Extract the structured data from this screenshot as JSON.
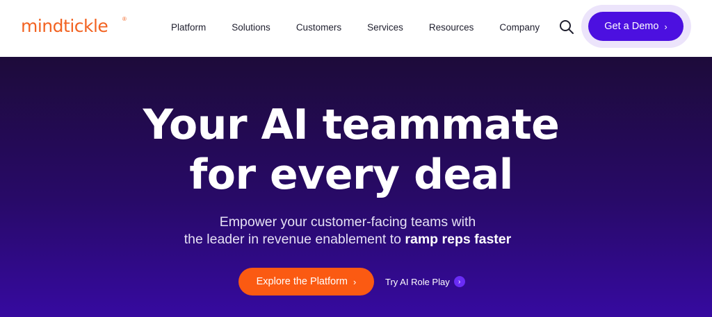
{
  "header": {
    "logo_text": "mindtickle",
    "logo_mark": "®",
    "nav": [
      {
        "label": "Platform"
      },
      {
        "label": "Solutions"
      },
      {
        "label": "Customers"
      },
      {
        "label": "Services"
      },
      {
        "label": "Resources"
      },
      {
        "label": "Company"
      }
    ],
    "search_icon": "search-icon",
    "demo_label": "Get a Demo",
    "demo_chevron": "›"
  },
  "hero": {
    "headline_line1": "Your AI teammate",
    "headline_line2": "for every deal",
    "sub_line1": "Empower your customer-facing teams with",
    "sub_line2_plain": "the leader in revenue enablement to",
    "sub_line2_bold": "ramp reps faster",
    "cta_primary": "Explore the Platform",
    "cta_primary_chevron": "›",
    "cta_secondary": "Try AI Role Play",
    "cta_secondary_chevron": "›"
  },
  "colors": {
    "brand_orange": "#f26322",
    "cta_orange": "#fb5a12",
    "demo_purple": "#4c10e0",
    "hero_top": "#1d0b3a",
    "hero_bottom": "#360aa0"
  }
}
